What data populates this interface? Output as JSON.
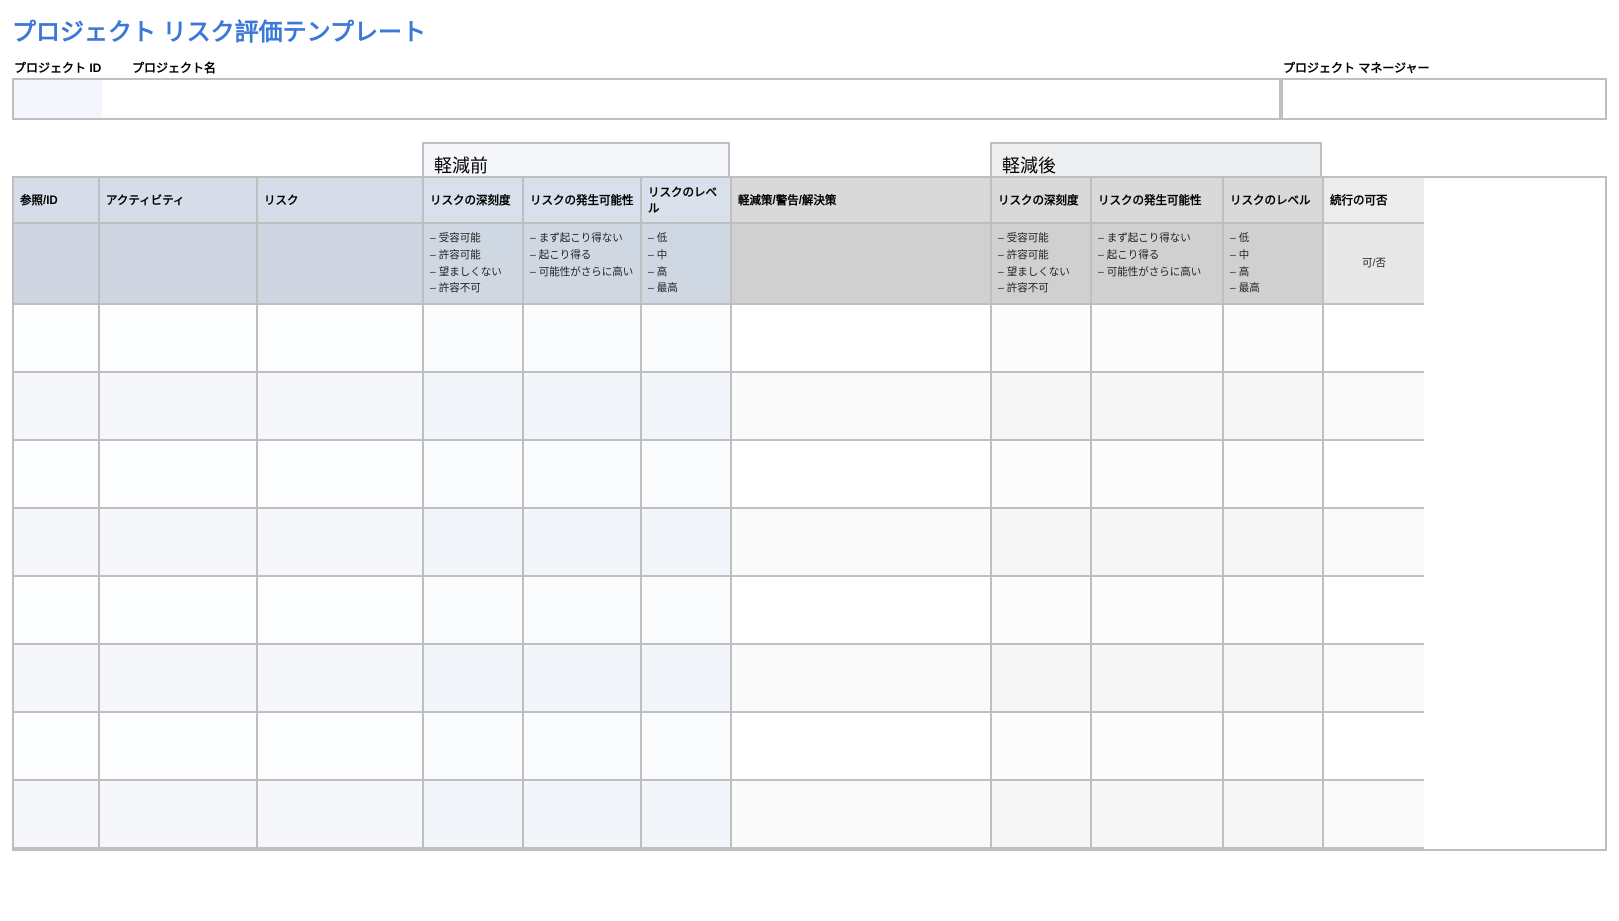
{
  "title": "プロジェクト リスク評価テンプレート",
  "header": {
    "project_id_label": "プロジェクト ID",
    "project_name_label": "プロジェクト名",
    "project_manager_label": "プロジェクト マネージャー",
    "project_id_value": "",
    "project_name_value": "",
    "project_manager_value": ""
  },
  "group_headers": {
    "pre": "軽減前",
    "post": "軽減後"
  },
  "columns": {
    "ref_id": "参照/ID",
    "activity": "アクティビティ",
    "risk": "リスク",
    "severity": "リスクの深刻度",
    "likelihood": "リスクの発生可能性",
    "level": "リスクのレベル",
    "mitigation": "軽減策/警告/解決策",
    "severity_post": "リスクの深刻度",
    "likelihood_post": "リスクの発生可能性",
    "level_post": "リスクのレベル",
    "continue": "続行の可否"
  },
  "options": {
    "severity": [
      "受容可能",
      "許容可能",
      "望ましくない",
      "許容不可"
    ],
    "likelihood": [
      "まず起こり得ない",
      "起こり得る",
      "可能性がさらに高い"
    ],
    "level": [
      "低",
      "中",
      "高",
      "最高"
    ],
    "continue_hint": "可/否"
  },
  "rows": [
    {
      "ref_id": "",
      "activity": "",
      "risk": "",
      "severity_pre": "",
      "likelihood_pre": "",
      "level_pre": "",
      "mitigation": "",
      "severity_post": "",
      "likelihood_post": "",
      "level_post": "",
      "continue": ""
    },
    {
      "ref_id": "",
      "activity": "",
      "risk": "",
      "severity_pre": "",
      "likelihood_pre": "",
      "level_pre": "",
      "mitigation": "",
      "severity_post": "",
      "likelihood_post": "",
      "level_post": "",
      "continue": ""
    },
    {
      "ref_id": "",
      "activity": "",
      "risk": "",
      "severity_pre": "",
      "likelihood_pre": "",
      "level_pre": "",
      "mitigation": "",
      "severity_post": "",
      "likelihood_post": "",
      "level_post": "",
      "continue": ""
    },
    {
      "ref_id": "",
      "activity": "",
      "risk": "",
      "severity_pre": "",
      "likelihood_pre": "",
      "level_pre": "",
      "mitigation": "",
      "severity_post": "",
      "likelihood_post": "",
      "level_post": "",
      "continue": ""
    },
    {
      "ref_id": "",
      "activity": "",
      "risk": "",
      "severity_pre": "",
      "likelihood_pre": "",
      "level_pre": "",
      "mitigation": "",
      "severity_post": "",
      "likelihood_post": "",
      "level_post": "",
      "continue": ""
    },
    {
      "ref_id": "",
      "activity": "",
      "risk": "",
      "severity_pre": "",
      "likelihood_pre": "",
      "level_pre": "",
      "mitigation": "",
      "severity_post": "",
      "likelihood_post": "",
      "level_post": "",
      "continue": ""
    },
    {
      "ref_id": "",
      "activity": "",
      "risk": "",
      "severity_pre": "",
      "likelihood_pre": "",
      "level_pre": "",
      "mitigation": "",
      "severity_post": "",
      "likelihood_post": "",
      "level_post": "",
      "continue": ""
    },
    {
      "ref_id": "",
      "activity": "",
      "risk": "",
      "severity_pre": "",
      "likelihood_pre": "",
      "level_pre": "",
      "mitigation": "",
      "severity_post": "",
      "likelihood_post": "",
      "level_post": "",
      "continue": ""
    }
  ]
}
